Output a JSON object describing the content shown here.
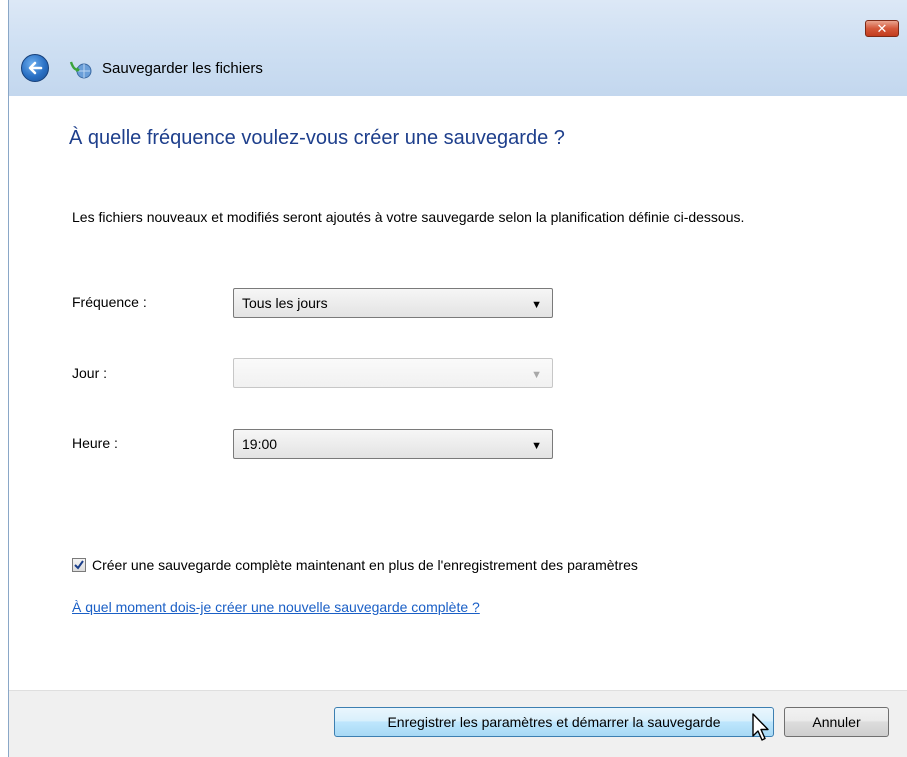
{
  "window": {
    "title": "Sauvegarder les fichiers",
    "close_glyph": "✕"
  },
  "page": {
    "heading": "À quelle fréquence voulez-vous créer une sauvegarde ?",
    "description": "Les fichiers nouveaux et modifiés seront ajoutés à votre sauvegarde selon la planification définie ci-dessous."
  },
  "fields": {
    "frequency": {
      "label": "Fréquence :",
      "value": "Tous les jours"
    },
    "day": {
      "label": "Jour :",
      "value": ""
    },
    "time": {
      "label": "Heure :",
      "value": "19:00"
    }
  },
  "options": {
    "full_backup_label": "Créer une sauvegarde complète maintenant en plus de l'enregistrement des paramètres",
    "full_backup_checked": true
  },
  "links": {
    "help": "À quel moment dois-je créer une nouvelle sauvegarde complète ?"
  },
  "buttons": {
    "save_start": "Enregistrer les paramètres et démarrer la sauvegarde",
    "cancel": "Annuler"
  },
  "icons": {
    "back": "back-arrow-icon",
    "app": "backup-icon",
    "dropdown": "dropdown-arrow-icon",
    "checkmark": "checkmark-icon",
    "cursor": "mouse-pointer-icon"
  },
  "colors": {
    "heading": "#1e3f8c",
    "link": "#1a5fc6",
    "close_button": "#c23c1e"
  }
}
